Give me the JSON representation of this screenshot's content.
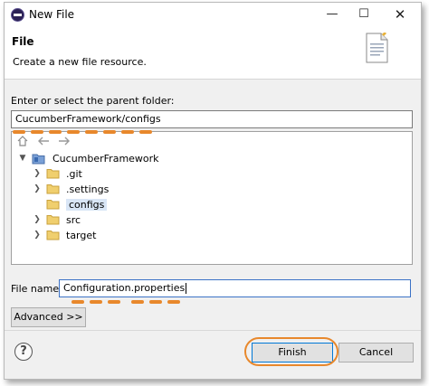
{
  "window": {
    "title": "New File",
    "controls": {
      "minimize": "—",
      "maximize": "☐",
      "close": "✕"
    }
  },
  "header": {
    "title": "File",
    "description": "Create a new file resource."
  },
  "parent_folder": {
    "label": "Enter or select the parent folder:",
    "value": "CucumberFramework/configs"
  },
  "tree": {
    "project": "CucumberFramework",
    "items": [
      {
        "label": ".git"
      },
      {
        "label": ".settings"
      },
      {
        "label": "configs",
        "selected": true
      },
      {
        "label": "src"
      },
      {
        "label": "target"
      }
    ]
  },
  "file_name": {
    "label": "File name:",
    "value": "Configuration.properties"
  },
  "buttons": {
    "advanced": "Advanced >>",
    "finish": "Finish",
    "cancel": "Cancel",
    "help": "?"
  },
  "colors": {
    "highlight": "#e8882c",
    "selection": "#d9e6f6",
    "accent": "#0078d7"
  }
}
